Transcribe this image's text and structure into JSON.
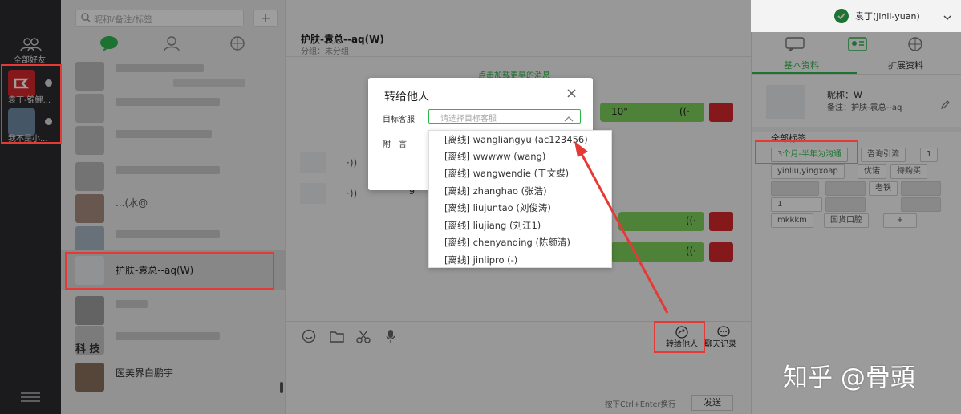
{
  "rail": {
    "all_friends_label": "全部好友",
    "accounts": [
      {
        "label": "袁丁-锦鲤..."
      },
      {
        "label": "我不是小..."
      }
    ]
  },
  "contact_list": {
    "search_placeholder": "昵称/备注/标签",
    "plus_glyph": "+",
    "visible_names": [
      {
        "name": "...(水@"
      },
      {
        "name": "护肤-袁总--aq(W)"
      },
      {
        "name": "医美界白鹏宇"
      }
    ],
    "watermark_chars": "科 技"
  },
  "chat": {
    "title": "护肤-袁总--aq(W)",
    "group_label": "分组：未分组",
    "load_more": "点击加载更早的消息",
    "voice_duration": "10\"",
    "partial_digit": "9",
    "toolbar": {
      "forward_label": "转给他人",
      "history_label": "聊天记录"
    },
    "send_hint": "按下Ctrl+Enter换行",
    "send_label": "发送"
  },
  "header": {
    "user_label": "袁丁(jinli-yuan)"
  },
  "profile": {
    "tabs": [
      "基本资料",
      "扩展资料"
    ],
    "nickname": "昵称：W",
    "remark": "备注：护肤-袁总--aq",
    "all_tags_label": "全部标签",
    "tags": [
      "3个月-半年为沟通",
      "咨询引流",
      "1",
      "yinliu,yingxoap",
      "优诺",
      "待购买",
      "老铁",
      "1",
      "mkkkm",
      "国货口腔",
      "+"
    ]
  },
  "modal": {
    "title": "转给他人",
    "close_glyph": "×",
    "target_label": "目标客服",
    "select_placeholder": "请选择目标客服",
    "note_label": "附　言",
    "options": [
      "[离线] wangliangyu (ac123456)",
      "[离线] wwwww (wang)",
      "[离线] wangwendie (王文蝶)",
      "[离线] zhanghao (张浩)",
      "[离线] liujuntao (刘俊涛)",
      "[离线] liujiang (刘江1)",
      "[离线] chenyanqing (陈颜清)",
      "[离线] jinlipro (-)"
    ]
  },
  "watermark": "知乎 @骨頭",
  "colors": {
    "accent_green": "#2db84d",
    "bubble_green": "#7ed15b",
    "highlight_red": "#e53935",
    "brand_red": "#d7262b"
  }
}
